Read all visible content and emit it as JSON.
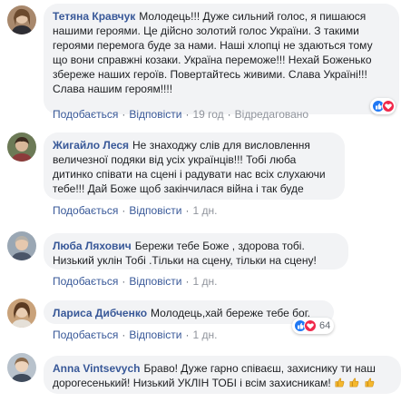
{
  "actions": {
    "like": "Подобається",
    "reply": "Відповісти",
    "separator": "·"
  },
  "comments": [
    {
      "author": "Тетяна Кравчук",
      "text": "Молодець!!! Дуже сильний голос, я пишаюся нашими героями. Це дійсно золотий голос України. З такими героями перемога буде за нами. Наші хлопці не здаються тому що вони справжні козаки. Україна переможе!!! Нехай Боженько збереже наших героїв. Повертайтесь живими. Слава Україні!!! Слава нашим героям!!!!",
      "time": "19 год",
      "edited": "Відредаговано"
    },
    {
      "author": "Жигайло Леся",
      "text": "Не знаходжу слів для висловлення величезної подяки від усіх українців!!! Тобі люба дитинко співати на сцені і радувати нас всіх слухаючи тебе!!! Дай Боже щоб закінчилася війна і так буде",
      "time": "1 дн."
    },
    {
      "author": "Люба Ляхович",
      "text": "Бережи тебе Боже , здорова тобі. Низький уклін Тобі .Тільки на сцену, тільки на сцену!",
      "time": "1 дн."
    },
    {
      "author": "Лариса Дибченко",
      "text": "Молодець,хай береже тебе бог.",
      "time": "1 дн.",
      "reaction_count": "64"
    },
    {
      "author": "Anna Vintsevych",
      "text": "Браво! Дуже гарно співаєш, захиснику ти наш дорогесенький! Низький УКЛІН ТОБІ і всім захисникам!",
      "time": "1 дн."
    }
  ],
  "colors": {
    "author_link": "#385898",
    "bubble_bg": "#f2f3f5",
    "meta_text": "#606770",
    "like_blue": "#2078f4",
    "love_red": "#f0284a"
  }
}
